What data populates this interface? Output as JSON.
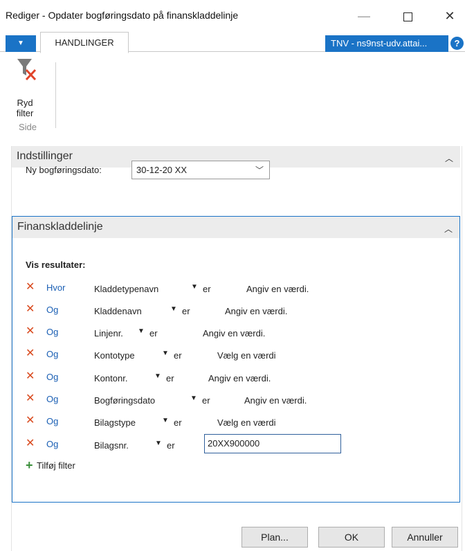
{
  "window": {
    "title": "Rediger - Opdater bogføringsdato på finanskladdelinje",
    "minimize": "—",
    "close": "✕"
  },
  "tabbar": {
    "tab_label": "HANDLINGER",
    "tenant": "TNV - ns9nst-udv.attai...",
    "help": "?"
  },
  "ribbon": {
    "button_label_line1": "Ryd",
    "button_label_line2": "filter",
    "group_label": "Side"
  },
  "settings": {
    "title": "Indstillinger",
    "field_label": "Ny bogføringsdato:",
    "field_value": "30-12-20 XX"
  },
  "journal": {
    "title": "Finanskladdelinje",
    "show_results": "Vis resultater:",
    "filters": [
      {
        "conj": "Hvor",
        "field": "Kladdetypenavn",
        "op": "er",
        "value": "Angiv en værdi."
      },
      {
        "conj": "Og",
        "field": "Kladdenavn",
        "op": "er",
        "value": "Angiv en værdi."
      },
      {
        "conj": "Og",
        "field": "Linjenr.",
        "op": "er",
        "value": "Angiv en værdi."
      },
      {
        "conj": "Og",
        "field": "Kontotype",
        "op": "er",
        "value": "Vælg en værdi"
      },
      {
        "conj": "Og",
        "field": "Kontonr.",
        "op": "er",
        "value": "Angiv en værdi."
      },
      {
        "conj": "Og",
        "field": "Bogføringsdato",
        "op": "er",
        "value": "Angiv en værdi."
      },
      {
        "conj": "Og",
        "field": "Bilagstype",
        "op": "er",
        "value": "Vælg en værdi"
      },
      {
        "conj": "Og",
        "field": "Bilagsnr.",
        "op": "er",
        "value": "20XX900000"
      }
    ],
    "add_filter": "Tilføj filter"
  },
  "buttons": {
    "plan": "Plan...",
    "ok": "OK",
    "cancel": "Annuller"
  },
  "colors": {
    "accent": "#1a73c6",
    "remove": "#d94a1e",
    "add": "#3a8e3a"
  }
}
